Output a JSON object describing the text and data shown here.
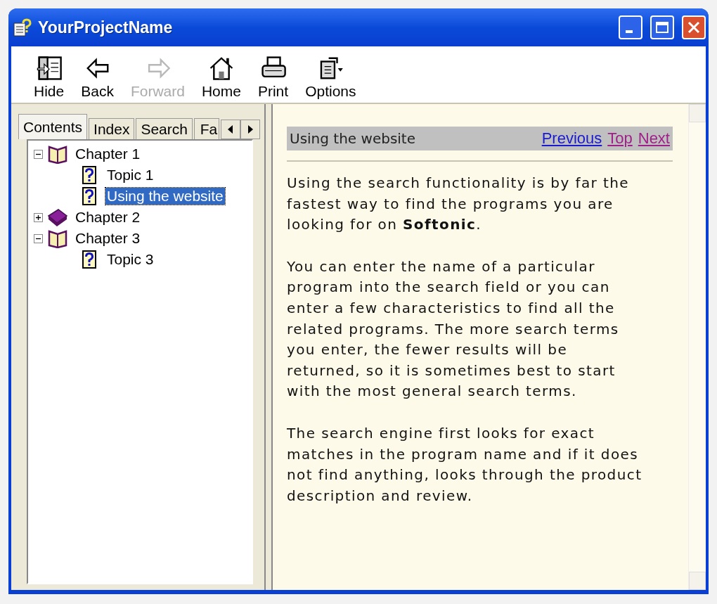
{
  "window": {
    "title": "YourProjectName"
  },
  "toolbar": [
    {
      "label": "Hide",
      "kind": "hide",
      "disabled": false
    },
    {
      "label": "Back",
      "kind": "back",
      "disabled": false
    },
    {
      "label": "Forward",
      "kind": "forward",
      "disabled": true
    },
    {
      "label": "Home",
      "kind": "home",
      "disabled": false
    },
    {
      "label": "Print",
      "kind": "print",
      "disabled": false
    },
    {
      "label": "Options",
      "kind": "options",
      "disabled": false
    }
  ],
  "tabs": [
    {
      "label": "Contents",
      "selected": true
    },
    {
      "label": "Index",
      "selected": false
    },
    {
      "label": "Search",
      "selected": false
    },
    {
      "label": "Fa",
      "selected": false
    }
  ],
  "tree": [
    {
      "label": "Chapter 1",
      "kind": "book",
      "expanded": true,
      "selected": false,
      "children": [
        {
          "label": "Topic 1",
          "kind": "topic",
          "selected": false
        },
        {
          "label": "Using the website",
          "kind": "topic",
          "selected": true
        }
      ]
    },
    {
      "label": "Chapter 2",
      "kind": "book",
      "expanded": false,
      "selected": false
    },
    {
      "label": "Chapter 3",
      "kind": "book",
      "expanded": true,
      "selected": false,
      "children": [
        {
          "label": "Topic 3",
          "kind": "topic",
          "selected": false
        }
      ]
    }
  ],
  "page": {
    "heading": "Using the website",
    "links": [
      {
        "label": "Previous",
        "visited": false
      },
      {
        "label": "Top",
        "visited": true
      },
      {
        "label": "Next",
        "visited": true
      }
    ],
    "paragraphs": [
      "Using the search functionality is by far the fastest way to find the programs you are looking for on **Softonic**.",
      "You can enter the name of a particular program into the search field or you can enter a few characteristics to find all the related programs. The more search terms you enter, the fewer results will be returned, so it is sometimes best to start with the most general search terms.",
      "The search engine first looks for exact matches in the program name and if it does not find anything, looks through the product description and review."
    ]
  }
}
